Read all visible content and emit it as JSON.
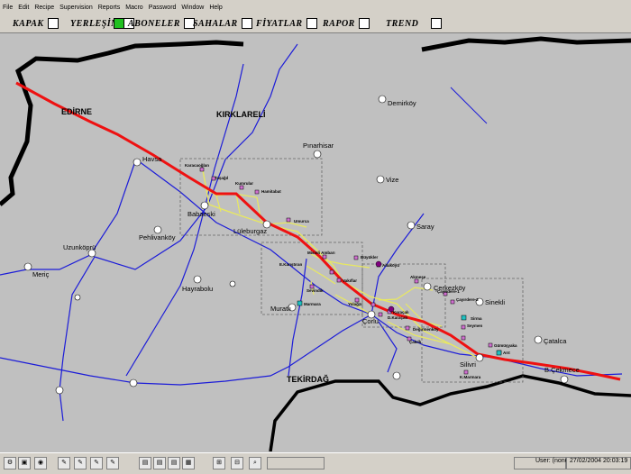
{
  "menu": [
    "File",
    "Edit",
    "Recipe",
    "Supervision",
    "Reports",
    "Macro",
    "Password",
    "Window",
    "Help"
  ],
  "tabs": [
    {
      "label": "KAPAK",
      "active": false
    },
    {
      "label": "YERLEŞİM",
      "active": false
    },
    {
      "label": "ABONELER",
      "active": true
    },
    {
      "label": "SAHALAR",
      "active": false
    },
    {
      "label": "FİYATLAR",
      "active": false
    },
    {
      "label": "RAPOR",
      "active": false
    },
    {
      "label": "TREND",
      "active": false
    }
  ],
  "map": {
    "regions": [
      "EDİRNE",
      "KIRKLARELİ",
      "TEKİRDAĞ"
    ],
    "cities": [
      "Demirköy",
      "Pınarhisar",
      "Havsa",
      "Vize",
      "Saray",
      "Babaeski",
      "Lüleburgaz",
      "Pehlivanköy",
      "Uzunköprü",
      "Meriç",
      "Hayrabolu",
      "Muratlı",
      "Çorlu",
      "Çerkezköy",
      "Sinekli",
      "Çatalca",
      "Silivri",
      "B.Çekmece"
    ],
    "subscribers": [
      "Karacaoğlan",
      "Taşağıl",
      "Kumrular",
      "Hamitabat",
      "Umurca",
      "Misinli Ambarı",
      "Büyükler",
      "Adaköyü",
      "E.Karıştıran",
      "Vakıflar",
      "Sevindik",
      "Yolağzı",
      "Akmeşe",
      "Çayırdere-1",
      "Çayırdere-2",
      "Marmara",
      "Karaçalı",
      "D.Karaçalı",
      "Değirmenköy",
      "Çakıllı",
      "Sirma",
      "Seymen",
      "Gümüşyaka",
      "Ortaköy",
      "Selimpaşa",
      "Arıt",
      "K.Marmara"
    ]
  },
  "statusbar": {
    "user": "User: (none)",
    "datetime": "27/02/2004  20:03:19"
  },
  "colors": {
    "pipeline": "#ee1111",
    "gasline": "#e8e860",
    "river": "#1c1cd8",
    "border": "#000000"
  }
}
